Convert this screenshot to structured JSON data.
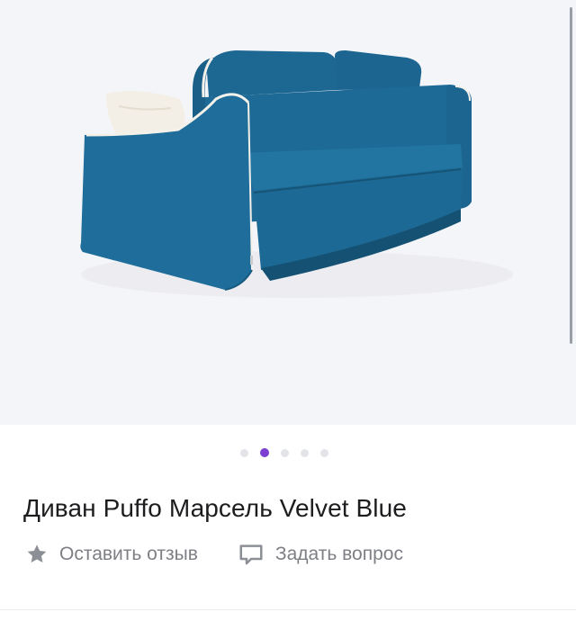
{
  "product": {
    "title": "Диван Puffo Марсель Velvet Blue",
    "image": {
      "subject": "sofa",
      "fabric_color": "#1f6d9a",
      "piping_color": "#f3f1ea",
      "pillow_color": "#f3efe6"
    }
  },
  "gallery": {
    "dots_count": 5,
    "active_index": 1,
    "active_color": "#7b3fd1",
    "inactive_color": "#e3e4e8"
  },
  "actions": {
    "review": {
      "label": "Оставить отзыв",
      "icon": "star-icon"
    },
    "question": {
      "label": "Задать вопрос",
      "icon": "chat-bubble-icon"
    }
  }
}
